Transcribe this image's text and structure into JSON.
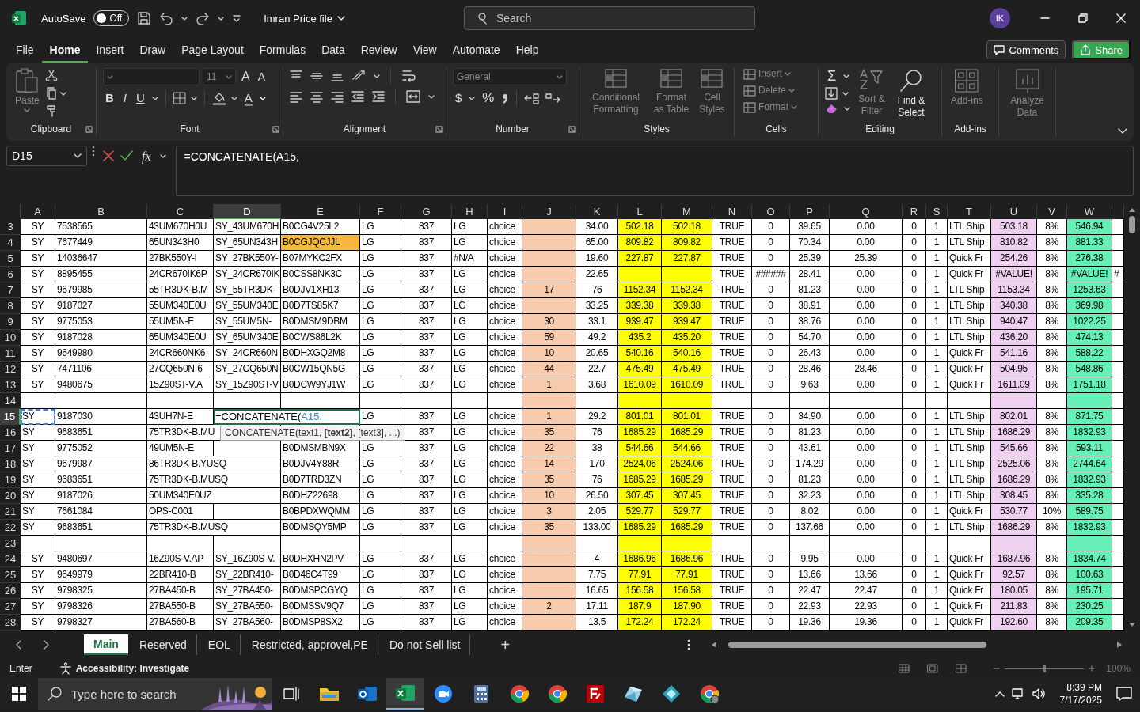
{
  "title_bar": {
    "autosave": {
      "label": "AutoSave",
      "state": "Off",
      "on": false
    },
    "file_title": "Imran Price file",
    "search": {
      "placeholder": "Search"
    },
    "avatar": "IK"
  },
  "menu_tabs": [
    {
      "label": "File",
      "selected": false
    },
    {
      "label": "Home",
      "selected": true
    },
    {
      "label": "Insert",
      "selected": false
    },
    {
      "label": "Draw",
      "selected": false
    },
    {
      "label": "Page Layout",
      "selected": false
    },
    {
      "label": "Formulas",
      "selected": false
    },
    {
      "label": "Data",
      "selected": false
    },
    {
      "label": "Review",
      "selected": false
    },
    {
      "label": "View",
      "selected": false
    },
    {
      "label": "Automate",
      "selected": false
    },
    {
      "label": "Help",
      "selected": false
    }
  ],
  "comments_button": "Comments",
  "share_button": "Share",
  "ribbon": {
    "groups": [
      {
        "label": "Clipboard",
        "paste": {
          "label": "Paste",
          "disabled": true
        }
      },
      {
        "label": "Font",
        "font_size": "11",
        "grow": "A",
        "shrink": "A",
        "bold": "B",
        "italic": "I",
        "underline": "U",
        "font_color": "A"
      },
      {
        "label": "Alignment"
      },
      {
        "label": "Number",
        "format": "General",
        "currency": "$",
        "percent": "%"
      },
      {
        "label": "Styles",
        "buttons": [
          {
            "label": "Conditional Formatting",
            "disabled": true
          },
          {
            "label": "Format as Table",
            "disabled": true
          },
          {
            "label": "Cell Styles",
            "disabled": true
          }
        ]
      },
      {
        "label": "Cells",
        "buttons": [
          {
            "label": "Insert",
            "disabled": true
          },
          {
            "label": "Delete",
            "disabled": true
          },
          {
            "label": "Format",
            "disabled": true
          }
        ]
      },
      {
        "label": "Editing",
        "sum": "Σ",
        "buttons": [
          {
            "label": "Sort & Filter",
            "disabled": true
          },
          {
            "label": "Find & Select",
            "disabled": false
          }
        ]
      },
      {
        "label": "Add-ins",
        "buttons": [
          {
            "label": "Add-ins",
            "disabled": true
          }
        ]
      },
      {
        "buttons": [
          {
            "label": "Analyze Data",
            "disabled": true
          }
        ]
      }
    ]
  },
  "formula_bar": {
    "name_box": "D15",
    "fx": "fx",
    "formula": "=CONCATENATE(A15,"
  },
  "sheet": {
    "columns": [
      {
        "letter": "A",
        "selected": false
      },
      {
        "letter": "B",
        "selected": false
      },
      {
        "letter": "C",
        "selected": false
      },
      {
        "letter": "D",
        "selected": true
      },
      {
        "letter": "E",
        "selected": false
      },
      {
        "letter": "F",
        "selected": false
      },
      {
        "letter": "G",
        "selected": false
      },
      {
        "letter": "H",
        "selected": false
      },
      {
        "letter": "I",
        "selected": false
      },
      {
        "letter": "J",
        "selected": false,
        "color": "#f8cbad"
      },
      {
        "letter": "K",
        "selected": false
      },
      {
        "letter": "L",
        "selected": false,
        "color": "#ffff00"
      },
      {
        "letter": "M",
        "selected": false,
        "color": "#ffff00"
      },
      {
        "letter": "N",
        "selected": false
      },
      {
        "letter": "O",
        "selected": false
      },
      {
        "letter": "P",
        "selected": false
      },
      {
        "letter": "Q",
        "selected": false
      },
      {
        "letter": "R",
        "selected": false
      },
      {
        "letter": "S",
        "selected": false
      },
      {
        "letter": "T",
        "selected": false
      },
      {
        "letter": "U",
        "selected": false,
        "color": "#f0d0f0"
      },
      {
        "letter": "V",
        "selected": false
      },
      {
        "letter": "W",
        "selected": false,
        "color": "#66f0b8"
      },
      {
        "selected": false
      }
    ],
    "function_tooltip": "CONCATENATE(text1, **[text2]**, [text3], ...)",
    "rows": [
      {
        "n": "3",
        "kind": "centered",
        "selected": false,
        "cells": [
          "SY",
          "7538565",
          "43UM670H0U",
          "SY_43UM670H",
          "B0CG4V25L2",
          "LG",
          "837",
          "LG",
          "choice",
          null,
          "34.00",
          "502.18",
          "502.18",
          "TRUE",
          "0",
          "39.65",
          "0.00",
          "0",
          "1",
          "LTL Ship",
          "503.18",
          "8%",
          "546.94",
          null
        ]
      },
      {
        "n": "4",
        "kind": "centered",
        "selected": false,
        "cells": [
          "SY",
          "7677449",
          "65UN343H0",
          "SY_65UN343H",
          {
            "text": "B0CGJQCJJL",
            "color": "#f5b83d"
          },
          "LG",
          "837",
          "LG",
          "choice",
          null,
          "65.00",
          "809.82",
          "809.82",
          "TRUE",
          "0",
          "70.34",
          "0.00",
          "0",
          "1",
          "LTL Ship",
          "810.82",
          "8%",
          "881.33",
          null
        ]
      },
      {
        "n": "5",
        "kind": "centered",
        "selected": false,
        "cells": [
          "SY",
          "14036647",
          "27BK550Y-I",
          "SY_27BK550Y-",
          "B07MYKC2FX",
          "LG",
          "837",
          "#N/A",
          "choice",
          null,
          "19.60",
          "227.87",
          "227.87",
          "TRUE",
          "0",
          "25.39",
          "25.39",
          "0",
          "1",
          "Quick Fr",
          "254.26",
          "8%",
          "276.38",
          null
        ]
      },
      {
        "n": "6",
        "kind": "centered",
        "selected": false,
        "cells": [
          "SY",
          "8895455",
          "24CR670IK6P",
          "SY_24CR670IK",
          "B0CSS8NK3C",
          "LG",
          "837",
          "LG",
          "choice",
          null,
          "22.65",
          null,
          null,
          "TRUE",
          "######",
          "28.41",
          "0.00",
          "0",
          "1",
          "Quick Fr",
          "#VALUE!",
          "8%",
          "#VALUE!",
          "#"
        ]
      },
      {
        "n": "7",
        "kind": "centered",
        "selected": false,
        "cells": [
          "SY",
          "9679985",
          "55TR3DK-B.M",
          "SY_55TR3DK-",
          "B0DJV1XH13",
          "LG",
          "837",
          "LG",
          "choice",
          "17",
          "76",
          "1152.34",
          "1152.34",
          "TRUE",
          "0",
          "81.23",
          "0.00",
          "0",
          "1",
          "LTL Ship",
          "1153.34",
          "8%",
          "1253.63",
          null
        ]
      },
      {
        "n": "8",
        "kind": "centered",
        "selected": false,
        "cells": [
          "SY",
          "9187027",
          "55UM340E0U",
          "SY_55UM340E",
          "B0D7TS85K7",
          "LG",
          "837",
          "LG",
          "choice",
          null,
          "33.25",
          "339.38",
          "339.38",
          "TRUE",
          "0",
          "38.91",
          "0.00",
          "0",
          "1",
          "LTL Ship",
          "340.38",
          "8%",
          "369.98",
          null
        ]
      },
      {
        "n": "9",
        "kind": "centered",
        "selected": false,
        "cells": [
          "SY",
          "9775053",
          "55UM5N-E",
          "SY_55UM5N-",
          "B0DMSM9DBM",
          "LG",
          "837",
          "LG",
          "choice",
          "30",
          "33.1",
          "939.47",
          "939.47",
          "TRUE",
          "0",
          "38.76",
          "0.00",
          "0",
          "1",
          "LTL Ship",
          "940.47",
          "8%",
          "1022.25",
          null
        ]
      },
      {
        "n": "10",
        "kind": "centered",
        "selected": false,
        "cells": [
          "SY",
          "9187028",
          "65UM340E0U",
          "SY_65UM340E",
          "B0CWS86L2K",
          "LG",
          "837",
          "LG",
          "choice",
          "59",
          "49.2",
          "435.2",
          "435.20",
          "TRUE",
          "0",
          "54.70",
          "0.00",
          "0",
          "1",
          "LTL Ship",
          "436.20",
          "8%",
          "474.13",
          null
        ]
      },
      {
        "n": "11",
        "kind": "centered",
        "selected": false,
        "cells": [
          "SY",
          "9649980",
          "24CR660NK6",
          "SY_24CR660N",
          "B0DHXGQ2M8",
          "LG",
          "837",
          "LG",
          "choice",
          "10",
          "20.65",
          "540.16",
          "540.16",
          "TRUE",
          "0",
          "26.43",
          "0.00",
          "0",
          "1",
          "Quick Fr",
          "541.16",
          "8%",
          "588.22",
          null
        ]
      },
      {
        "n": "12",
        "kind": "centered",
        "selected": false,
        "cells": [
          "SY",
          "7471106",
          "27CQ650N-6",
          "SY_27CQ650N",
          "B0CW15QN5G",
          "LG",
          "837",
          "LG",
          "choice",
          "44",
          "22.7",
          "475.49",
          "475.49",
          "TRUE",
          "0",
          "28.46",
          "28.46",
          "0",
          "1",
          "Quick Fr",
          "504.95",
          "8%",
          "548.86",
          null
        ]
      },
      {
        "n": "13",
        "kind": "centered",
        "selected": false,
        "cells": [
          "SY",
          "9480675",
          "15Z90ST-V.A",
          "SY_15Z90ST-V",
          "B0DCW9YJ1W",
          "LG",
          "837",
          "LG",
          "choice",
          "1",
          "3.68",
          "1610.09",
          "1610.09",
          "TRUE",
          "0",
          "9.63",
          "0.00",
          "0",
          "1",
          "Quick Fr",
          "1611.09",
          "8%",
          "1751.18",
          null
        ]
      },
      {
        "n": "14",
        "kind": "centered",
        "selected": false,
        "cells": [
          null,
          null,
          null,
          null,
          null,
          null,
          null,
          null,
          null,
          null,
          null,
          null,
          null,
          null,
          null,
          null,
          null,
          null,
          null,
          null,
          null,
          null,
          null,
          null
        ]
      },
      {
        "n": "15",
        "kind": "left",
        "selected": true,
        "cells": [
          {
            "text": "SY",
            "referenced": true
          },
          "9187030",
          "43UH7N-E",
          {
            "kind": "editor",
            "prefix": "=CONCATENATE(",
            "reference": "A15",
            "suffix": ","
          },
          null,
          "LG",
          "837",
          "LG",
          "choice",
          "1",
          "29.2",
          "801.01",
          "801.01",
          "TRUE",
          "0",
          "34.90",
          "0.00",
          "0",
          "1",
          "LTL Ship",
          "802.01",
          "8%",
          "871.75",
          null
        ]
      },
      {
        "n": "16",
        "kind": "left",
        "selected": false,
        "cells": [
          "SY",
          "9683651",
          "75TR3DK-B.MU",
          null,
          null,
          null,
          "837",
          "LG",
          "choice",
          "35",
          "76",
          "1685.29",
          "1685.29",
          "TRUE",
          "0",
          "81.23",
          "0.00",
          "0",
          "1",
          "LTL Ship",
          "1686.29",
          "8%",
          "1832.93",
          null
        ]
      },
      {
        "n": "17",
        "kind": "left",
        "selected": false,
        "cells": [
          "SY",
          "9775052",
          "49UM5N-E",
          null,
          "B0DMSMBN9X",
          "LG",
          "837",
          "LG",
          "choice",
          "22",
          "38",
          "544.66",
          "544.66",
          "TRUE",
          "0",
          "43.61",
          "0.00",
          "0",
          "1",
          "LTL Ship",
          "545.66",
          "8%",
          "593.11",
          null
        ]
      },
      {
        "n": "18",
        "kind": "left",
        "selected": false,
        "cells": [
          "SY",
          "9679987",
          "86TR3DK-B.YUSQ",
          null,
          "B0DJV4Y88R",
          "LG",
          "837",
          "LG",
          "choice",
          "14",
          "170",
          "2524.06",
          "2524.06",
          "TRUE",
          "0",
          "174.29",
          "0.00",
          "0",
          "1",
          "LTL Ship",
          "2525.06",
          "8%",
          "2744.64",
          null
        ]
      },
      {
        "n": "19",
        "kind": "left",
        "selected": false,
        "cells": [
          "SY",
          "9683651",
          "75TR3DK-B.MUSQ",
          null,
          "B0D7TRD3ZN",
          "LG",
          "837",
          "LG",
          "choice",
          "35",
          "76",
          "1685.29",
          "1685.29",
          "TRUE",
          "0",
          "81.23",
          "0.00",
          "0",
          "1",
          "LTL Ship",
          "1686.29",
          "8%",
          "1832.93",
          null
        ]
      },
      {
        "n": "20",
        "kind": "left",
        "selected": false,
        "cells": [
          "SY",
          "9187026",
          "50UM340E0UZ",
          null,
          "B0DHZ22698",
          "LG",
          "837",
          "LG",
          "choice",
          "10",
          "26.50",
          "307.45",
          "307.45",
          "TRUE",
          "0",
          "32.23",
          "0.00",
          "0",
          "1",
          "LTL Ship",
          "308.45",
          "8%",
          "335.28",
          null
        ]
      },
      {
        "n": "21",
        "kind": "left",
        "selected": false,
        "cells": [
          "SY",
          "7661084",
          "OPS-C001",
          null,
          "B0BPDXWQMM",
          "LG",
          "837",
          "LG",
          "choice",
          "3",
          "2.05",
          "529.77",
          "529.77",
          "TRUE",
          "0",
          "8.02",
          "0.00",
          "0",
          "1",
          "Quick Fr",
          "530.77",
          "10%",
          "589.75",
          null
        ]
      },
      {
        "n": "22",
        "kind": "left",
        "selected": false,
        "cells": [
          "SY",
          "9683651",
          "75TR3DK-B.MUSQ",
          null,
          "B0DMSQY5MP",
          "LG",
          "837",
          "LG",
          "choice",
          "35",
          "133.00",
          "1685.29",
          "1685.29",
          "TRUE",
          "0",
          "137.66",
          "0.00",
          "0",
          "1",
          "LTL Ship",
          "1686.29",
          "8%",
          "1832.93",
          null
        ]
      },
      {
        "n": "23",
        "kind": "centered",
        "selected": false,
        "cells": [
          null,
          null,
          null,
          null,
          null,
          null,
          null,
          null,
          null,
          null,
          null,
          null,
          null,
          null,
          null,
          null,
          null,
          null,
          null,
          null,
          null,
          null,
          null,
          null
        ]
      },
      {
        "n": "24",
        "kind": "centered",
        "selected": false,
        "cells": [
          "SY",
          "9480697",
          "16Z90S-V.AP",
          "SY_16Z90S-V.",
          "B0DHXHN2PV",
          "LG",
          "837",
          "LG",
          "choice",
          null,
          "4",
          "1686.96",
          "1686.96",
          "TRUE",
          "0",
          "9.95",
          "0.00",
          "0",
          "1",
          "Quick Fr",
          "1687.96",
          "8%",
          "1834.74",
          null
        ]
      },
      {
        "n": "25",
        "kind": "centered",
        "selected": false,
        "cells": [
          "SY",
          "9649979",
          "22BR410-B",
          "SY_22BR410-",
          "B0D46C4T99",
          "LG",
          "837",
          "LG",
          "choice",
          null,
          "7.75",
          "77.91",
          "77.91",
          "TRUE",
          "0",
          "13.66",
          "13.66",
          "0",
          "1",
          "Quick Fr",
          "92.57",
          "8%",
          "100.63",
          null
        ]
      },
      {
        "n": "26",
        "kind": "centered",
        "selected": false,
        "cells": [
          "SY",
          "9798325",
          "27BA450-B",
          "SY_27BA450-",
          "B0DMSPCGYQ",
          "LG",
          "837",
          "LG",
          "choice",
          null,
          "16.65",
          "156.58",
          "156.58",
          "TRUE",
          "0",
          "22.47",
          "22.47",
          "0",
          "1",
          "Quick Fr",
          "180.05",
          "8%",
          "195.71",
          null
        ]
      },
      {
        "n": "27",
        "kind": "centered",
        "selected": false,
        "cells": [
          "SY",
          "9798326",
          "27BA550-B",
          "SY_27BA550-",
          "B0DMSSV9Q7",
          "LG",
          "837",
          "LG",
          "choice",
          "2",
          "17.11",
          "187.9",
          "187.90",
          "TRUE",
          "0",
          "22.93",
          "22.93",
          "0",
          "1",
          "Quick Fr",
          "211.83",
          "8%",
          "230.25",
          null
        ]
      },
      {
        "n": "28",
        "kind": "centered",
        "selected": false,
        "cells": [
          "SY",
          "9798327",
          "27BA560-B",
          "SY_27BA560-",
          "B0DMSP8SX2",
          "LG",
          "837",
          "LG",
          "choice",
          null,
          "13.5",
          "172.24",
          "172.24",
          "TRUE",
          "0",
          "19.36",
          "19.36",
          "0",
          "1",
          "Quick Fr",
          "192.60",
          "8%",
          "209.35",
          null
        ]
      }
    ]
  },
  "sheet_tabs": [
    {
      "label": "Main",
      "selected": true
    },
    {
      "label": "Reserved",
      "selected": false
    },
    {
      "label": "EOL",
      "selected": false
    },
    {
      "label": "Restricted, approvel,PE",
      "selected": false
    },
    {
      "label": "Do not Sell list",
      "selected": false
    }
  ],
  "add_sheet": "+",
  "status_bar": {
    "mode": "Enter",
    "accessibility": "Accessibility: Investigate",
    "zoom_slider": {
      "level": 0.5
    },
    "zoom": "100%"
  },
  "taskbar": {
    "search": {
      "placeholder": "Type here to search"
    },
    "time": "8:39 PM",
    "date": "7/17/2025"
  }
}
